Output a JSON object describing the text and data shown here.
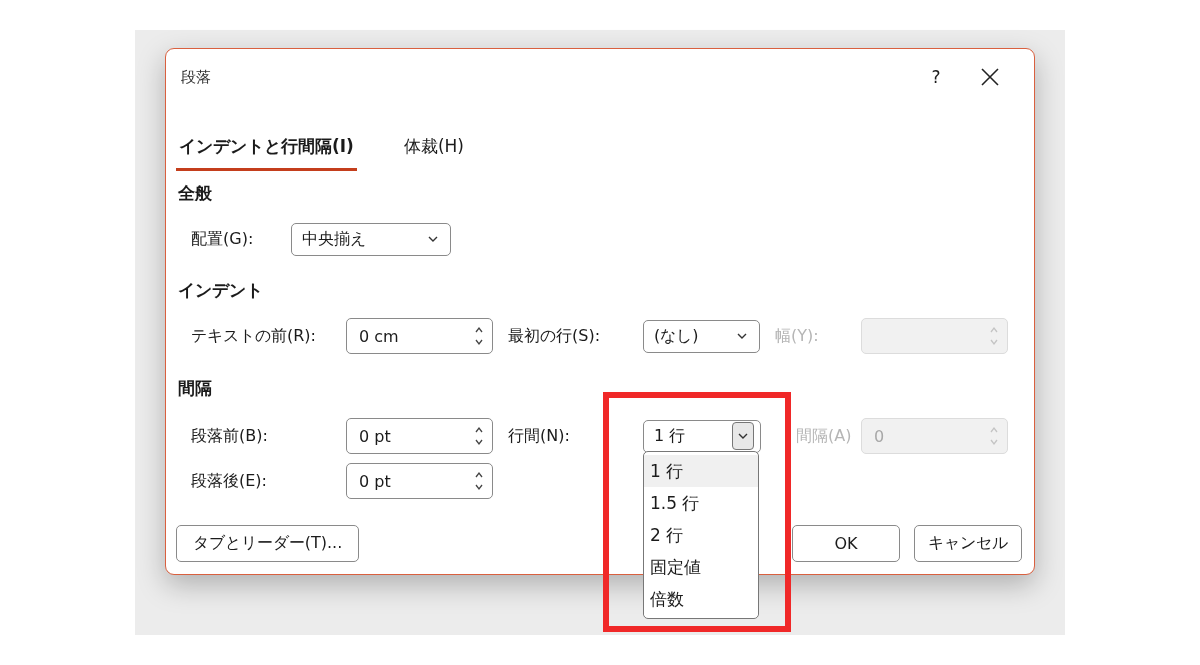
{
  "dialog": {
    "title": "段落",
    "help": "?"
  },
  "tabs": [
    {
      "label": "インデントと行間隔(I)",
      "selected": true
    },
    {
      "label": "体裁(H)",
      "selected": false
    }
  ],
  "general": {
    "heading": "全般",
    "alignment": {
      "label": "配置(G):",
      "value": "中央揃え"
    }
  },
  "indent": {
    "heading": "インデント",
    "before_text": {
      "label": "テキストの前(R):",
      "value": "0 cm"
    },
    "first_line": {
      "label": "最初の行(S):",
      "value": "(なし)"
    },
    "by": {
      "label": "幅(Y):",
      "disabled": true
    }
  },
  "spacing": {
    "heading": "間隔",
    "before": {
      "label": "段落前(B):",
      "value": "0 pt"
    },
    "after": {
      "label": "段落後(E):",
      "value": "0 pt"
    },
    "line_spacing": {
      "label": "行間(N):",
      "value": "1 行",
      "expanded": true,
      "options": [
        {
          "label": "1 行",
          "selected": true
        },
        {
          "label": "1.5 行",
          "selected": false
        },
        {
          "label": "2 行",
          "selected": false
        },
        {
          "label": "固定値",
          "selected": false
        },
        {
          "label": "倍数",
          "selected": false
        }
      ]
    },
    "at": {
      "label": "間隔(A)",
      "value": "0",
      "disabled": true
    }
  },
  "buttons": {
    "tabs": "タブとリーダー(T)...",
    "ok": "OK",
    "cancel": "キャンセル"
  }
}
